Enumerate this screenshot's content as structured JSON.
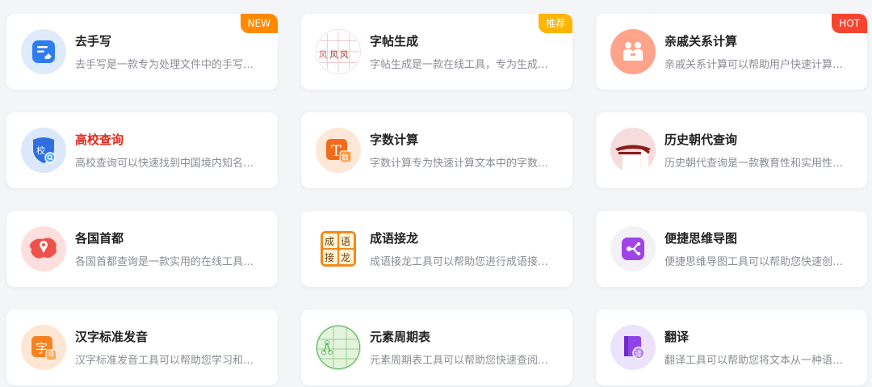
{
  "tools": [
    {
      "title": "去手写",
      "desc": "去手写是一款专为处理文件中的手写内容设计的在线工具",
      "badge": "NEW",
      "badge_color": "#ff8a00",
      "icon": "eraser-doc-icon",
      "title_color": ""
    },
    {
      "title": "字帖生成",
      "desc": "字帖生成是一款在线工具，专为生成书法练习字帖设计",
      "badge": "推荐",
      "badge_color": "#ffb400",
      "icon": "copybook-grid-icon",
      "title_color": ""
    },
    {
      "title": "亲戚关系计算",
      "desc": "亲戚关系计算可以帮助用户快速计算亲戚之间的称呼",
      "badge": "HOT",
      "badge_color": "#f5452f",
      "icon": "family-people-icon",
      "title_color": ""
    },
    {
      "title": "高校查询",
      "desc": "高校查询可以快速找到中国境内知名高校的相关信息",
      "badge": "",
      "badge_color": "",
      "icon": "school-shield-icon",
      "title_color": "#e5281e"
    },
    {
      "title": "字数计算",
      "desc": "字数计算专为快速计算文本中的字数而设计的在线工具",
      "badge": "",
      "badge_color": "",
      "icon": "text-count-icon",
      "title_color": ""
    },
    {
      "title": "历史朝代查询",
      "desc": "历史朝代查询是一款教育性和实用性兼具的在线工具",
      "badge": "",
      "badge_color": "",
      "icon": "palace-roof-icon",
      "title_color": ""
    },
    {
      "title": "各国首都",
      "desc": "各国首都查询是一款实用的在线工具，方便查询首都",
      "badge": "",
      "badge_color": "",
      "icon": "map-pin-icon",
      "title_color": ""
    },
    {
      "title": "成语接龙",
      "desc": "成语接龙工具可以帮助您进行成语接龙游戏并学习成语",
      "badge": "",
      "badge_color": "",
      "icon": "idiom-tiles-icon",
      "title_color": ""
    },
    {
      "title": "便捷思维导图",
      "desc": "便捷思维导图工具可以帮助您快速创建清晰的思维导图",
      "badge": "",
      "badge_color": "",
      "icon": "mindmap-icon",
      "title_color": ""
    },
    {
      "title": "汉字标准发音",
      "desc": "汉字标准发音工具可以帮助您学习和掌握汉字的标准读音",
      "badge": "",
      "badge_color": "",
      "icon": "char-sound-icon",
      "title_color": ""
    },
    {
      "title": "元素周期表",
      "desc": "元素周期表工具可以帮助您快速查阅化学元素的信息",
      "badge": "",
      "badge_color": "",
      "icon": "periodic-table-icon",
      "title_color": ""
    },
    {
      "title": "翻译",
      "desc": "翻译工具可以帮助您将文本从一种语言翻译成另一种语言",
      "badge": "",
      "badge_color": "",
      "icon": "translate-book-icon",
      "title_color": ""
    }
  ]
}
